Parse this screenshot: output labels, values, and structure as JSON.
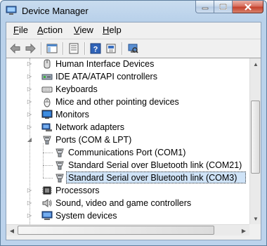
{
  "window": {
    "title": "Device Manager"
  },
  "menu": {
    "file": "File",
    "file_key": "F",
    "file_rest": "ile",
    "action": "Action",
    "action_key": "A",
    "action_rest": "ction",
    "view": "View",
    "view_key": "V",
    "view_rest": "iew",
    "help": "Help",
    "help_key": "H",
    "help_rest": "elp"
  },
  "toolbar": {
    "buttons": [
      "back-icon",
      "forward-icon",
      "show-hide-console-tree-icon",
      "properties-icon",
      "help-icon",
      "update-driver-icon",
      "scan-hardware-icon"
    ]
  },
  "tree": {
    "items": [
      {
        "label": "Human Interface Devices",
        "icon": "hid-icon",
        "expanded": false
      },
      {
        "label": "IDE ATA/ATAPI controllers",
        "icon": "ide-controller-icon",
        "expanded": false
      },
      {
        "label": "Keyboards",
        "icon": "keyboard-icon",
        "expanded": false
      },
      {
        "label": "Mice and other pointing devices",
        "icon": "mouse-icon",
        "expanded": false
      },
      {
        "label": "Monitors",
        "icon": "monitor-icon",
        "expanded": false
      },
      {
        "label": "Network adapters",
        "icon": "network-adapter-icon",
        "expanded": false
      },
      {
        "label": "Ports (COM & LPT)",
        "icon": "port-icon",
        "expanded": true,
        "children": [
          {
            "label": "Communications Port (COM1)",
            "icon": "port-icon"
          },
          {
            "label": "Standard Serial over Bluetooth link (COM21)",
            "icon": "port-icon"
          },
          {
            "label": "Standard Serial over Bluetooth link (COM3)",
            "icon": "port-icon",
            "selected": true
          }
        ]
      },
      {
        "label": "Processors",
        "icon": "processor-icon",
        "expanded": false
      },
      {
        "label": "Sound, video and game controllers",
        "icon": "sound-icon",
        "expanded": false
      },
      {
        "label": "System devices",
        "icon": "system-devices-icon",
        "expanded": false
      }
    ]
  },
  "colors": {
    "selection": "#cfe3f7",
    "title_bg": "#b9d1ea",
    "close_button": "#c4412c"
  }
}
